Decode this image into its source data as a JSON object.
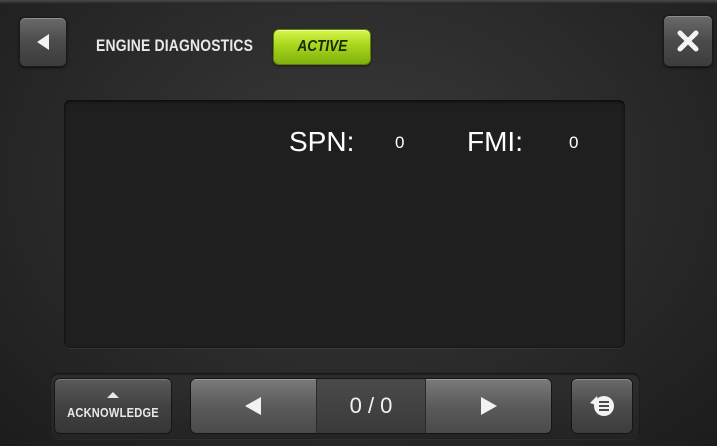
{
  "header": {
    "title": "ENGINE DIAGNOSTICS",
    "status_badge": "ACTIVE",
    "back_icon": "back-arrow-icon",
    "close_icon": "close-icon"
  },
  "fault": {
    "spn_label": "SPN:",
    "spn_value": "0",
    "fmi_label": "FMI:",
    "fmi_value": "0"
  },
  "footer": {
    "acknowledge_label": "ACKNOWLEDGE",
    "pager_text": "0 / 0",
    "prev_icon": "previous-arrow-icon",
    "next_icon": "next-arrow-icon",
    "reset_icon": "reset-icon"
  },
  "colors": {
    "active_badge": "#a8d51e",
    "background": "#2a2a2a",
    "panel": "#1f1f1f"
  }
}
